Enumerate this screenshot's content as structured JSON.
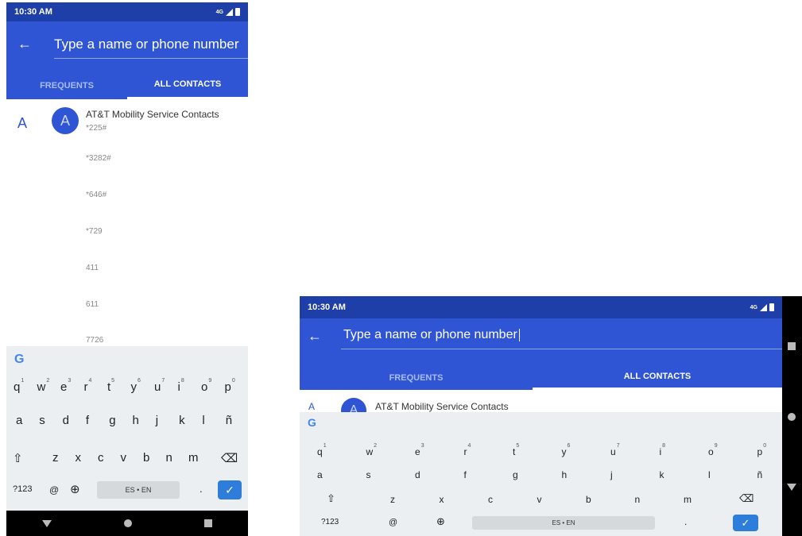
{
  "status": {
    "time": "10:30 AM",
    "network": "4G"
  },
  "search": {
    "placeholder": "Type a name or phone number"
  },
  "tabs": [
    "FREQUENTS",
    "ALL CONTACTS"
  ],
  "contacts": {
    "section_letter": "A",
    "avatar_letter": "A",
    "name": "AT&T Mobility Service Contacts",
    "numbers": [
      "*225#",
      "*3282#",
      "*646#",
      "*729",
      "411",
      "611",
      "7726"
    ]
  },
  "keyboard": {
    "logo": "G",
    "row1": [
      {
        "k": "q",
        "n": "1"
      },
      {
        "k": "w",
        "n": "2"
      },
      {
        "k": "e",
        "n": "3"
      },
      {
        "k": "r",
        "n": "4"
      },
      {
        "k": "t",
        "n": "5"
      },
      {
        "k": "y",
        "n": "6"
      },
      {
        "k": "u",
        "n": "7"
      },
      {
        "k": "i",
        "n": "8"
      },
      {
        "k": "o",
        "n": "9"
      },
      {
        "k": "p",
        "n": "0"
      }
    ],
    "row2": [
      "a",
      "s",
      "d",
      "f",
      "g",
      "h",
      "j",
      "k",
      "l",
      "ñ"
    ],
    "row3": [
      "z",
      "x",
      "c",
      "v",
      "b",
      "n",
      "m"
    ],
    "shift": "⇧",
    "backspace": "⌫",
    "symbols": "?123",
    "at": "@",
    "globe": "⊕",
    "space": "ES • EN",
    "period": ".",
    "enter": "✓"
  },
  "colors": {
    "status_bar": "#1f3fa8",
    "app_bar": "#2f55d4",
    "accent": "#2f55d4",
    "enter_key": "#2f7ddb"
  }
}
